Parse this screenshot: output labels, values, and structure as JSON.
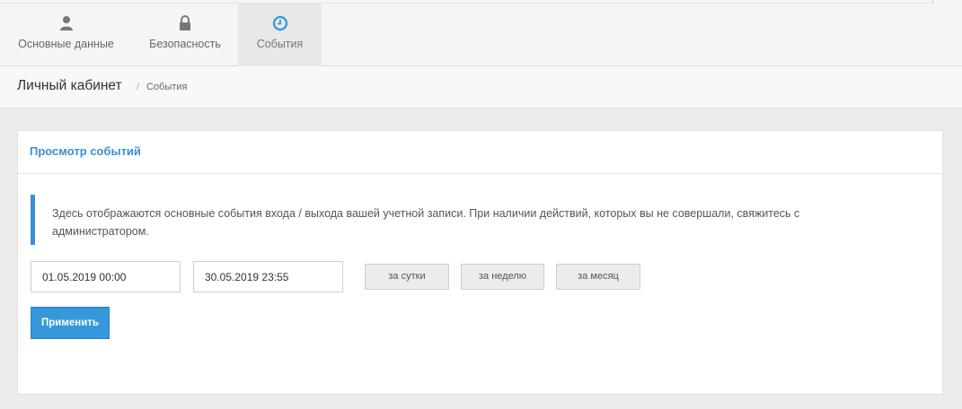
{
  "tabs": [
    {
      "label": "Основные данные",
      "icon": "user-icon"
    },
    {
      "label": "Безопасность",
      "icon": "lock-icon"
    },
    {
      "label": "События",
      "icon": "clock-icon"
    }
  ],
  "breadcrumb": {
    "title": "Личный кабинет",
    "separator": "/",
    "current": "События"
  },
  "panel": {
    "title": "Просмотр событий",
    "note": "Здесь отображаются основные события входа / выхода вашей учетной записи. При наличии действий, которых вы не совершали, свяжитесь с администратором."
  },
  "filter": {
    "date_from": "01.05.2019 00:00",
    "date_to": "30.05.2019 23:55",
    "btn_day": "за сутки",
    "btn_week": "за неделю",
    "btn_month": "за месяц",
    "apply": "Применить"
  },
  "colors": {
    "accent": "#3498db",
    "icon_gray": "#777777"
  }
}
